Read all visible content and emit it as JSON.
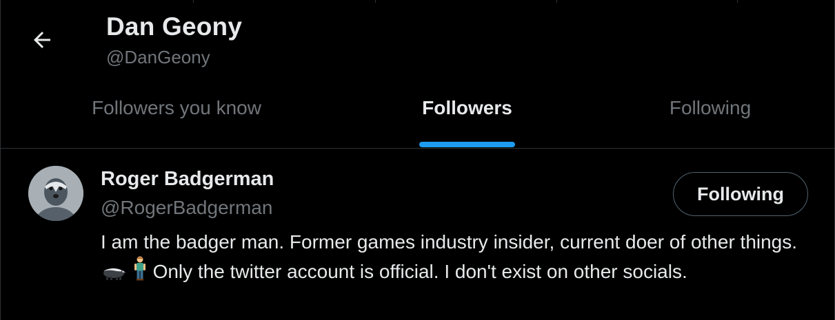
{
  "header": {
    "title": "Dan Geony",
    "handle": "@DanGeony",
    "back_icon": "arrow-left-icon"
  },
  "tabs": [
    {
      "label": "Followers you know",
      "active": false
    },
    {
      "label": "Followers",
      "active": true
    },
    {
      "label": "Following",
      "active": false
    }
  ],
  "users": [
    {
      "name": "Roger Badgerman",
      "handle": "@RogerBadgerman",
      "button_label": "Following",
      "bio_part1": "I am the badger man. Former games industry insider, current doer of other things.",
      "bio_part2": "Only the twitter account is official. I don't exist on other socials.",
      "bio_emojis": [
        "badger",
        "man-standing"
      ]
    }
  ],
  "colors": {
    "background": "#000000",
    "text_primary": "#e7e9ea",
    "text_secondary": "#71767b",
    "accent": "#1d9bf0",
    "border": "#2f3336"
  }
}
